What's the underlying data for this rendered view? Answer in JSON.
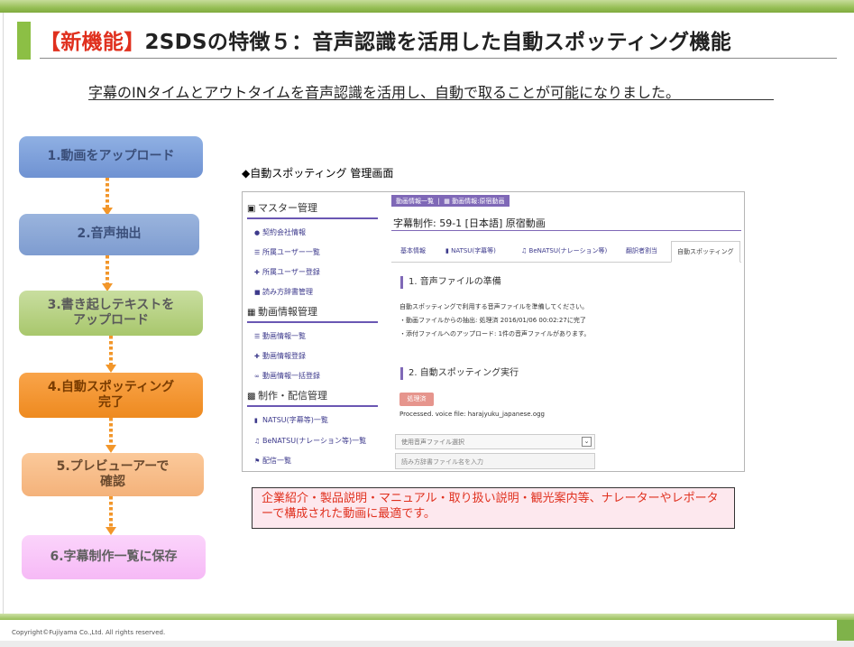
{
  "slide": {
    "title_highlight": "【新機能】",
    "title_rest": "2SDSの特徴５：音声認識を活用した自動スポッティング機能",
    "subtitle": "字幕のINタイムとアウトタイムを音声認識を活用し、自動で取ることが可能になりました。",
    "steps": [
      {
        "label": "1.動画をアップロード"
      },
      {
        "label": "2.音声抽出"
      },
      {
        "label": "3.書き起しテキストを\nアップロード"
      },
      {
        "label": "4.自動スポッティング\n完了"
      },
      {
        "label": "5.プレビューアーで\n確認"
      },
      {
        "label": "6.字幕制作一覧に保存"
      }
    ],
    "screenshot_caption": "◆自動スポッティング 管理画面",
    "note": "企業紹介・製品説明・マニュアル・取り扱い説明・観光案内等、ナレーターやレポーターで構成された動画に最適です。",
    "copyright": "Copyright©Fujiyama Co.,Ltd. All rights reserved.",
    "colors": {
      "accent_green": "#8cbf45",
      "title_highlight": "#e0301e",
      "purple": "#7f68b7",
      "step_orange": "#f2962a"
    }
  },
  "app": {
    "sidebar": {
      "sections": [
        {
          "label": "マスター管理",
          "icon": "briefcase-icon"
        },
        {
          "label": "動画情報管理",
          "icon": "film-icon"
        },
        {
          "label": "制作・配信管理",
          "icon": "cc-icon"
        }
      ],
      "items": [
        {
          "label": "契約会社情報",
          "icon": "info-icon"
        },
        {
          "label": "所属ユーザー一覧",
          "icon": "list-icon"
        },
        {
          "label": "所属ユーザー登録",
          "icon": "plus-icon"
        },
        {
          "label": "読み方辞書管理",
          "icon": "book-icon"
        },
        {
          "label": "動画情報一覧",
          "icon": "list-icon"
        },
        {
          "label": "動画情報登録",
          "icon": "plus-icon"
        },
        {
          "label": "動画情報一括登録",
          "icon": "link-icon"
        },
        {
          "label": "NATSU(字幕等)一覧",
          "icon": "file-icon"
        },
        {
          "label": "BeNATSU(ナレーション等)一覧",
          "icon": "mic-icon"
        },
        {
          "label": "配信一覧",
          "icon": "flag-icon"
        }
      ]
    },
    "breadcrumb": {
      "first": "動画情報一覧",
      "second": "動画情報:原宿動画"
    },
    "subtitle_title": "字幕制作: 59-1 [日本語] 原宿動画",
    "tabs": [
      {
        "label": "基本情報"
      },
      {
        "label": "NATSU(字幕等)"
      },
      {
        "label": "BeNATSU(ナレーション等)"
      },
      {
        "label": "翻訳者割当"
      },
      {
        "label": "自動スポッティング"
      }
    ],
    "section1": {
      "title": "1. 音声ファイルの準備",
      "lines": [
        "自動スポッティングで利用する音声ファイルを準備してください。",
        "・動画ファイルからの抽出: 処理済 2016/01/06 00:02:27に完了",
        "・添付ファイルへのアップロード: 1件の音声ファイルがあります。"
      ]
    },
    "section2": {
      "title": "2. 自動スポッティング実行",
      "button": "処理済",
      "processed_text": "Processed. voice file: harajyuku_japanese.ogg",
      "select_placeholder": "使用音声ファイル選択",
      "input_placeholder": "読み方辞書ファイル名を入力"
    }
  }
}
